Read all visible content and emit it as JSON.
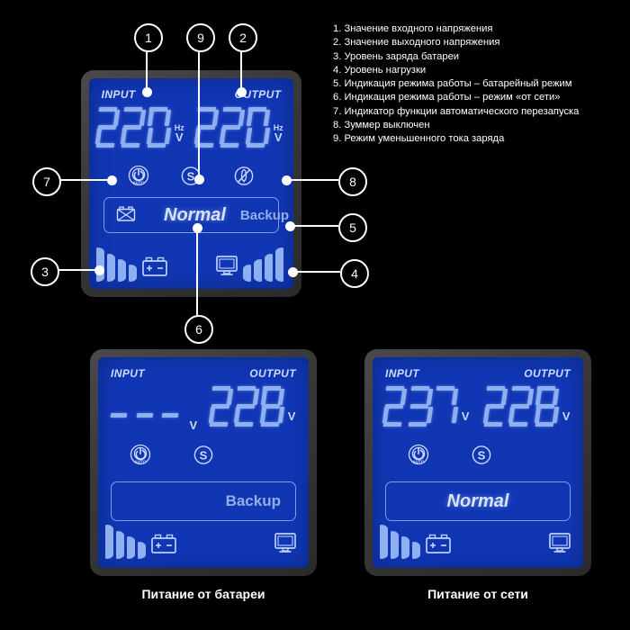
{
  "legend": {
    "items": [
      "1. Значение входного напряжения",
      "2. Значение выходного напряжения",
      "3. Уровень заряда батареи",
      "4. Уровень нагрузки",
      "5. Индикация режима работы – батарейный режим",
      "6. Индикация режима работы – режим «от сети»",
      "7. Индикатор функции автоматического перезапуска",
      "8. Зуммер выключен",
      "9. Режим уменьшенного тока заряда"
    ]
  },
  "colors": {
    "lcd_background": "#1036b4",
    "segment_on": "#8fb0f0",
    "bezel": "#3a3a3a",
    "text_light": "#cfdcff",
    "callout": "#ffffff",
    "page_background": "#000000"
  },
  "main_panel": {
    "input_label": "INPUT",
    "output_label": "OUTPUT",
    "input_value": "220",
    "input_unit_hz": "Hz",
    "input_unit_v": "V",
    "output_value": "220",
    "output_unit_hz": "Hz",
    "output_unit_v": "V",
    "icons": {
      "auto_restart": "auto-restart-icon",
      "auto_restart_label": "AUTO",
      "reduced_charge": "S",
      "buzzer_off": "buzzer-off-icon"
    },
    "mode_battery_icon": "battery-mode-icon",
    "mode_normal": "Normal",
    "mode_backup": "Backup",
    "battery_icon": "battery-icon",
    "load_icon": "monitor-icon",
    "battery_bars": 4,
    "load_bars": 4
  },
  "callouts": [
    {
      "number": "1"
    },
    {
      "number": "2"
    },
    {
      "number": "3"
    },
    {
      "number": "4"
    },
    {
      "number": "5"
    },
    {
      "number": "6"
    },
    {
      "number": "7"
    },
    {
      "number": "8"
    },
    {
      "number": "9"
    }
  ],
  "battery_panel": {
    "input_label": "INPUT",
    "output_label": "OUTPUT",
    "input_value": "---",
    "input_unit_v": "V",
    "output_value": "228",
    "output_unit_v": "V",
    "mode_text": "Backup",
    "caption": "Питание от батареи",
    "battery_bars": 4,
    "load_bars": 0
  },
  "mains_panel": {
    "input_label": "INPUT",
    "output_label": "OUTPUT",
    "input_value": "237",
    "input_unit_v": "V",
    "output_value": "228",
    "output_unit_v": "V",
    "mode_text": "Normal",
    "caption": "Питание от сети",
    "battery_bars": 4,
    "load_bars": 0
  }
}
